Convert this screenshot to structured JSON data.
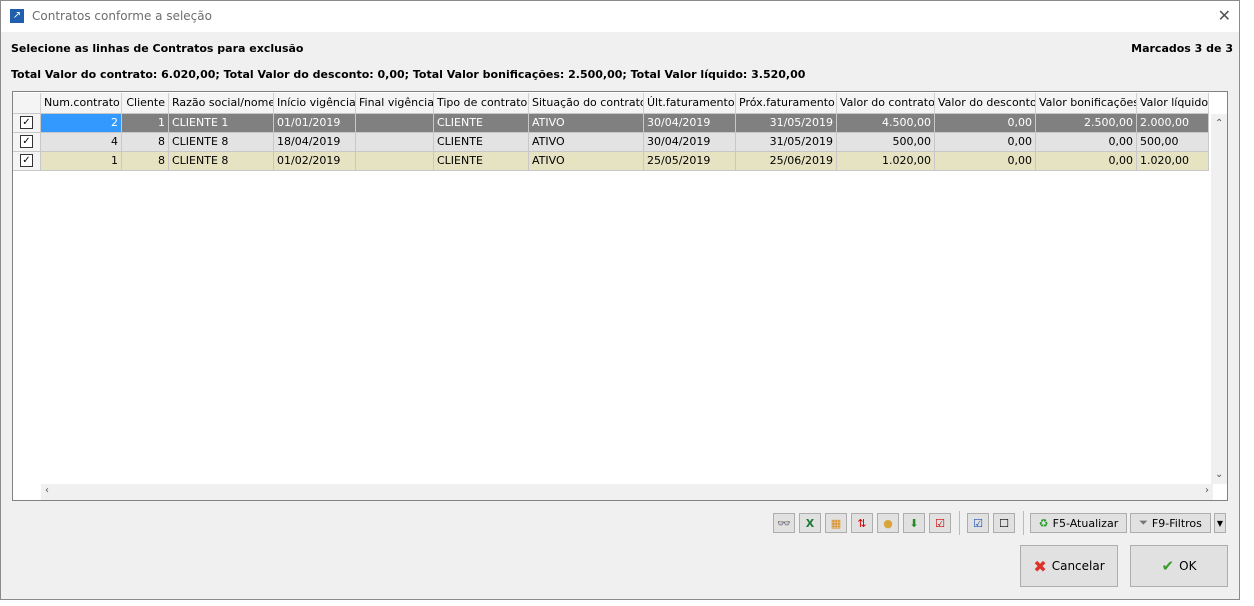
{
  "window": {
    "title": "Contratos conforme a seleção",
    "close_label": "✕"
  },
  "header": {
    "instruction": "Selecione as linhas de Contratos para exclusão",
    "marked": "Marcados 3 de 3",
    "totals": "Total Valor do contrato: 6.020,00; Total Valor do desconto: 0,00; Total Valor bonificações: 2.500,00; Total Valor líquido: 3.520,00"
  },
  "grid": {
    "columns": [
      "Num.contrato",
      "Cliente",
      "Razão social/nome",
      "Início vigência",
      "Final vigência",
      "Tipo de contrato",
      "Situação do contrato",
      "Últ.faturamento",
      "Próx.faturamento",
      "Valor do contrato",
      "Valor do desconto",
      "Valor bonificações",
      "Valor líquido"
    ],
    "rows": [
      {
        "checked": true,
        "cells": [
          "2",
          "1",
          "CLIENTE 1",
          "01/01/2019",
          "",
          "CLIENTE",
          "ATIVO",
          "30/04/2019",
          "31/05/2019",
          "4.500,00",
          "0,00",
          "2.500,00",
          "2.000,00"
        ]
      },
      {
        "checked": true,
        "cells": [
          "4",
          "8",
          "CLIENTE 8",
          "18/04/2019",
          "",
          "CLIENTE",
          "ATIVO",
          "30/04/2019",
          "31/05/2019",
          "500,00",
          "0,00",
          "0,00",
          "500,00"
        ]
      },
      {
        "checked": true,
        "cells": [
          "1",
          "8",
          "CLIENTE 8",
          "01/02/2019",
          "",
          "CLIENTE",
          "ATIVO",
          "25/05/2019",
          "25/06/2019",
          "1.020,00",
          "0,00",
          "0,00",
          "1.020,00"
        ]
      }
    ],
    "row_colors": [
      "#808080",
      "#e3e3e3",
      "#e6e3c3"
    ],
    "selected_cell_color": "#3399ff"
  },
  "toolbar": {
    "refresh": "F5-Atualizar",
    "filters": "F9-Filtros"
  },
  "buttons": {
    "cancel": "Cancelar",
    "ok": "OK"
  }
}
